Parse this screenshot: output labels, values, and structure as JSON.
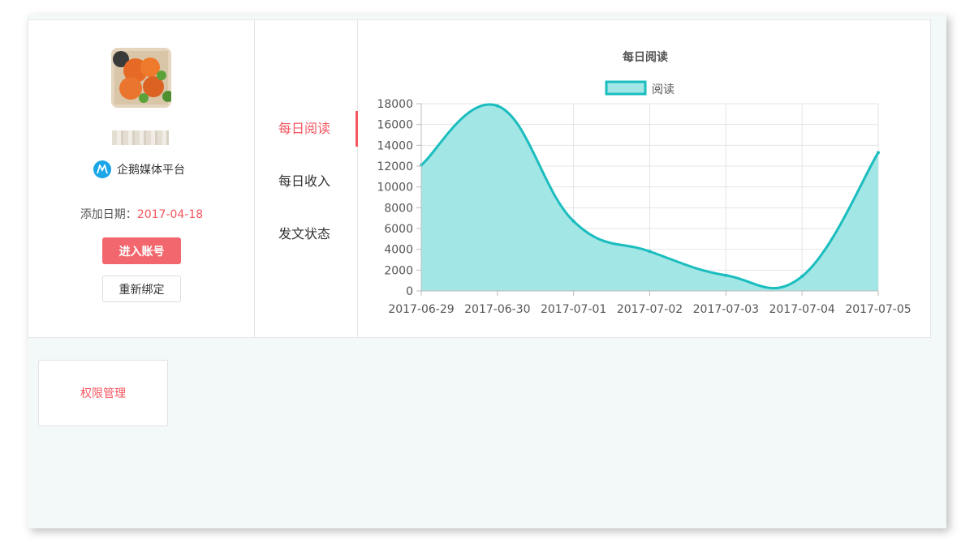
{
  "account": {
    "platform_name": "企鹅媒体平台",
    "date_label": "添加日期：",
    "date_value": "2017-04-18",
    "enter_button": "进入账号",
    "rebind_button": "重新绑定"
  },
  "menu": {
    "items": [
      {
        "label": "每日阅读",
        "active": true
      },
      {
        "label": "每日收入",
        "active": false
      },
      {
        "label": "发文状态",
        "active": false
      }
    ]
  },
  "permission_card": {
    "label": "权限管理"
  },
  "colors": {
    "accent": "#f5565f",
    "series_line": "#1bbdbf",
    "series_fill": "#a2e6e6"
  },
  "chart_data": {
    "type": "area",
    "title": "每日阅读",
    "categories": [
      "2017-06-29",
      "2017-06-30",
      "2017-07-01",
      "2017-07-02",
      "2017-07-03",
      "2017-07-04",
      "2017-07-05"
    ],
    "series": [
      {
        "name": "阅读",
        "values": [
          12100,
          17800,
          6700,
          3800,
          1500,
          1400,
          13300
        ]
      }
    ],
    "ylim": [
      0,
      18000
    ],
    "yticks": [
      0,
      2000,
      4000,
      6000,
      8000,
      10000,
      12000,
      14000,
      16000,
      18000
    ],
    "grid": true,
    "legend": "top-center"
  }
}
